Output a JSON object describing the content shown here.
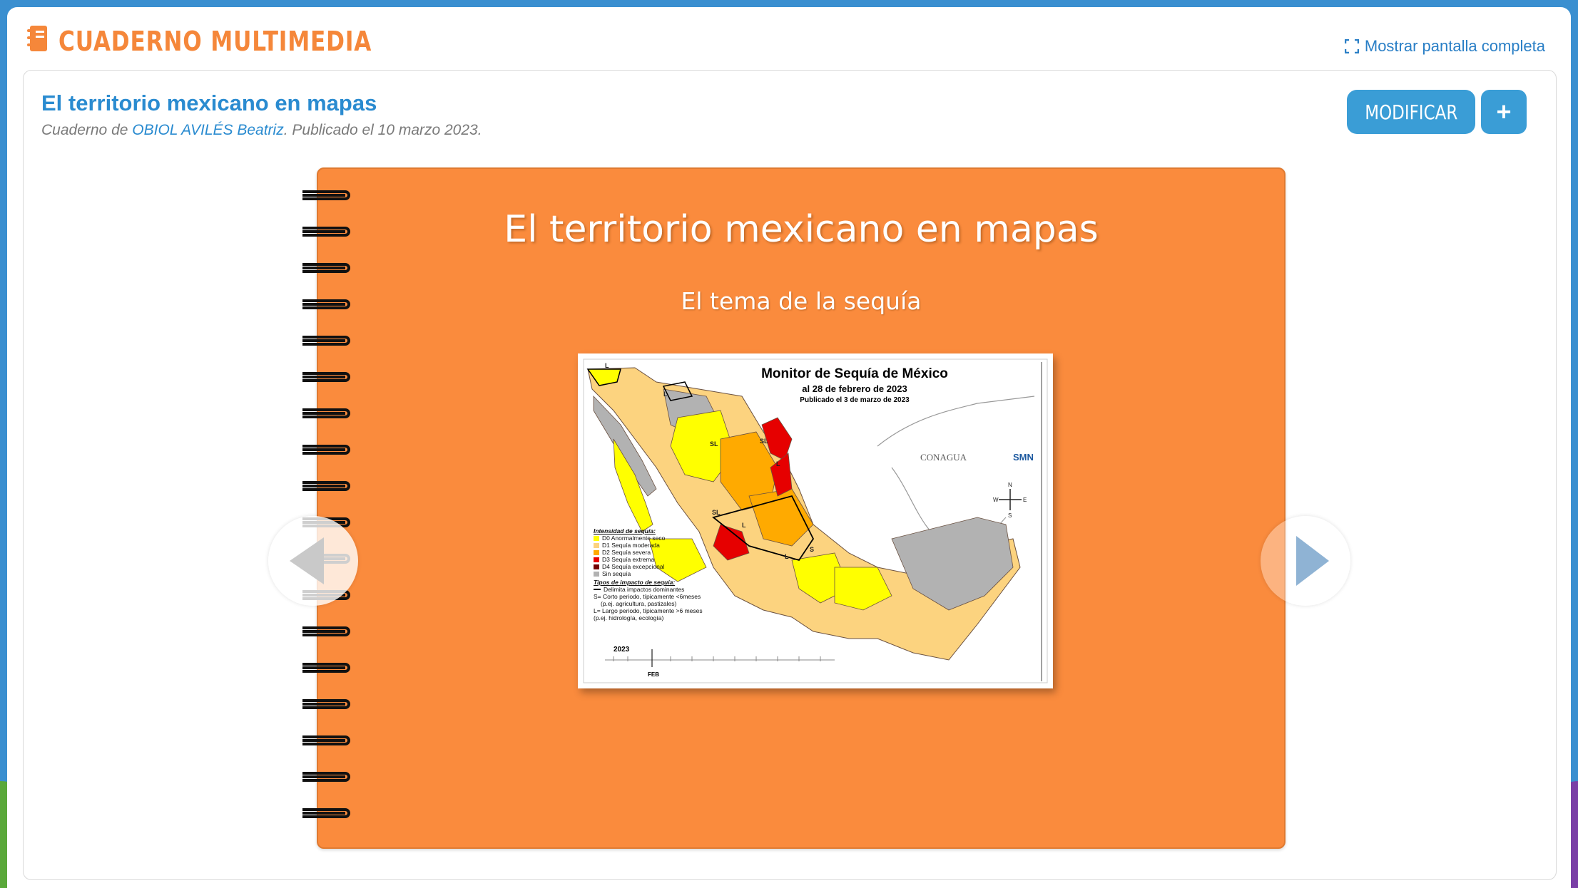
{
  "app": {
    "name": "CUADERNO MULTIMEDIA",
    "fullscreen_label": "Mostrar pantalla completa"
  },
  "notebook": {
    "title": "El territorio mexicano en mapas",
    "meta_prefix": "Cuaderno de ",
    "author": "OBIOL AVILÉS Beatriz",
    "meta_suffix": ". Publicado el 10 marzo 2023.",
    "modify_label": "MODIFICAR",
    "add_label": "+"
  },
  "slide": {
    "title": "El territorio mexicano en mapas",
    "subtitle": "El tema de la sequía",
    "map": {
      "title": "Monitor de Sequía de México",
      "date": "al 28 de febrero de 2023",
      "published": "Publicado el 3 de marzo de 2023",
      "logo_conagua": "CONAGUA",
      "logo_smn": "SMN",
      "legend_heading": "Intensidad de sequía:",
      "legend": [
        {
          "label": "D0 Anormalmente seco",
          "color": "#ffff00"
        },
        {
          "label": "D1 Sequía moderada",
          "color": "#fcd37f"
        },
        {
          "label": "D2 Sequía severa",
          "color": "#ffaa00"
        },
        {
          "label": "D3 Sequía extrema",
          "color": "#e60000"
        },
        {
          "label": "D4 Sequía excepcional",
          "color": "#730000"
        },
        {
          "label": "Sin sequía",
          "color": "#b2b2b2"
        }
      ],
      "impact_heading": "Tipos de impacto de sequía:",
      "impact_line": "Delimita impactos dominantes",
      "impact_s": "S= Corto periodo, típicamente <6meses",
      "impact_s_ex": "(p.ej. agricultura, pastizales)",
      "impact_l": "L= Largo periodo, típicamente >6 meses",
      "impact_l_ex": "(p.ej. hidrología, ecología)",
      "year": "2023",
      "feb": "FEB"
    }
  },
  "colors": {
    "accent_orange": "#f5873a",
    "notebook_orange": "#fa8b3d",
    "link_blue": "#2a8bd0",
    "button_blue": "#3a9dd6"
  },
  "icons": {
    "logo": "notebook-logo-icon",
    "fullscreen": "expand-icon",
    "prev": "arrow-left-icon",
    "next": "arrow-right-icon"
  }
}
